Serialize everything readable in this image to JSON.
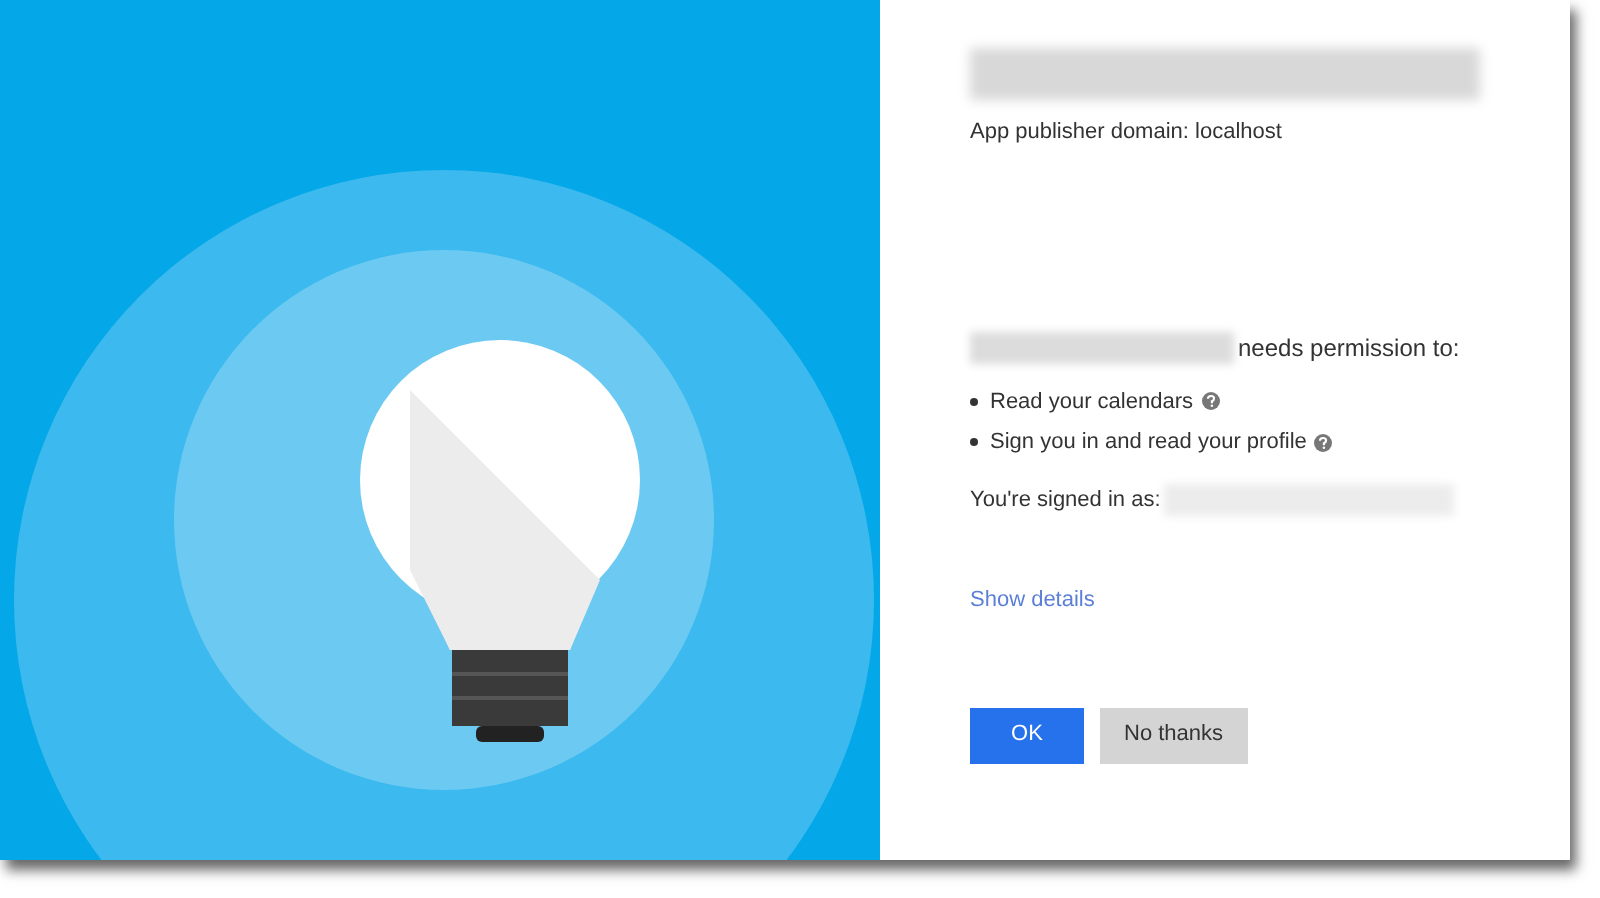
{
  "publisher_line": "App publisher domain: localhost",
  "permission_intro": "needs permission to:",
  "permissions": [
    {
      "label": "Read your calendars"
    },
    {
      "label": "Sign you in and read your profile"
    }
  ],
  "signed_in_label": "You're signed in as:",
  "details_link": "Show details",
  "buttons": [
    {
      "label": "OK",
      "kind": "primary"
    },
    {
      "label": "No thanks",
      "kind": "secondary"
    }
  ]
}
